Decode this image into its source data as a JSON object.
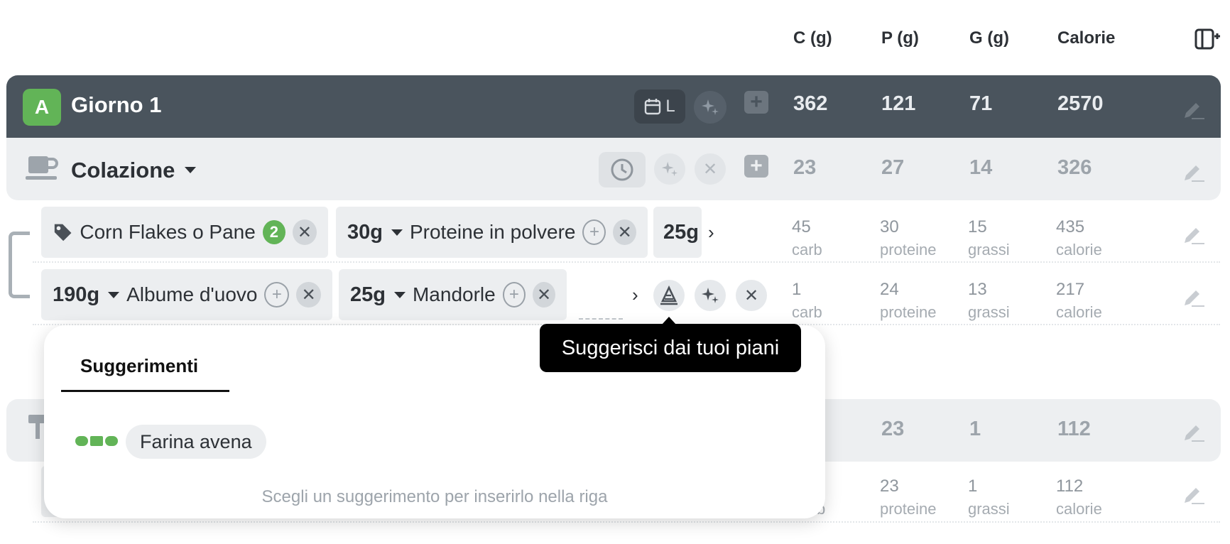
{
  "columns": {
    "c": "C (g)",
    "p": "P (g)",
    "g": "G (g)",
    "cal": "Calorie"
  },
  "day": {
    "avatar": "A",
    "title": "Giorno 1",
    "chip_letter": "L",
    "c": "362",
    "p": "121",
    "g": "71",
    "cal": "2570"
  },
  "meal": {
    "title": "Colazione",
    "c": "23",
    "p": "27",
    "g": "14",
    "cal": "326"
  },
  "rows": [
    {
      "foods": [
        {
          "name": "Corn Flakes o Pane",
          "badge": "2"
        },
        {
          "qty": "30",
          "unit": "g",
          "name": "Proteine in polvere"
        },
        {
          "qty": "25",
          "unit": "g"
        }
      ],
      "c": "45",
      "c_unit": "carb",
      "p": "30",
      "p_unit": "proteine",
      "g": "15",
      "g_unit": "grassi",
      "cal": "435",
      "cal_unit": "calorie"
    },
    {
      "foods": [
        {
          "qty": "190",
          "unit": "g",
          "name": "Albume d'uovo"
        },
        {
          "qty": "25",
          "unit": "g",
          "name": "Mandorle"
        }
      ],
      "c": "1",
      "c_unit": "carb",
      "p": "24",
      "p_unit": "proteine",
      "g": "13",
      "g_unit": "grassi",
      "cal": "217",
      "cal_unit": "calorie"
    }
  ],
  "meal2": {
    "p": "23",
    "g": "1",
    "cal": "112"
  },
  "row3": {
    "c_unit": "b",
    "p": "23",
    "p_unit": "proteine",
    "g": "1",
    "g_unit": "grassi",
    "cal": "112",
    "cal_unit": "calorie"
  },
  "popup": {
    "tab": "Suggerimenti",
    "suggestion": "Farina avena",
    "hint": "Scegli un suggerimento per inserirlo nella riga"
  },
  "tooltip": "Suggerisci dai tuoi piani",
  "colors": {
    "dark_bar": "#4a545d",
    "accent_green": "#62b457",
    "light_bar": "#edeff1"
  }
}
